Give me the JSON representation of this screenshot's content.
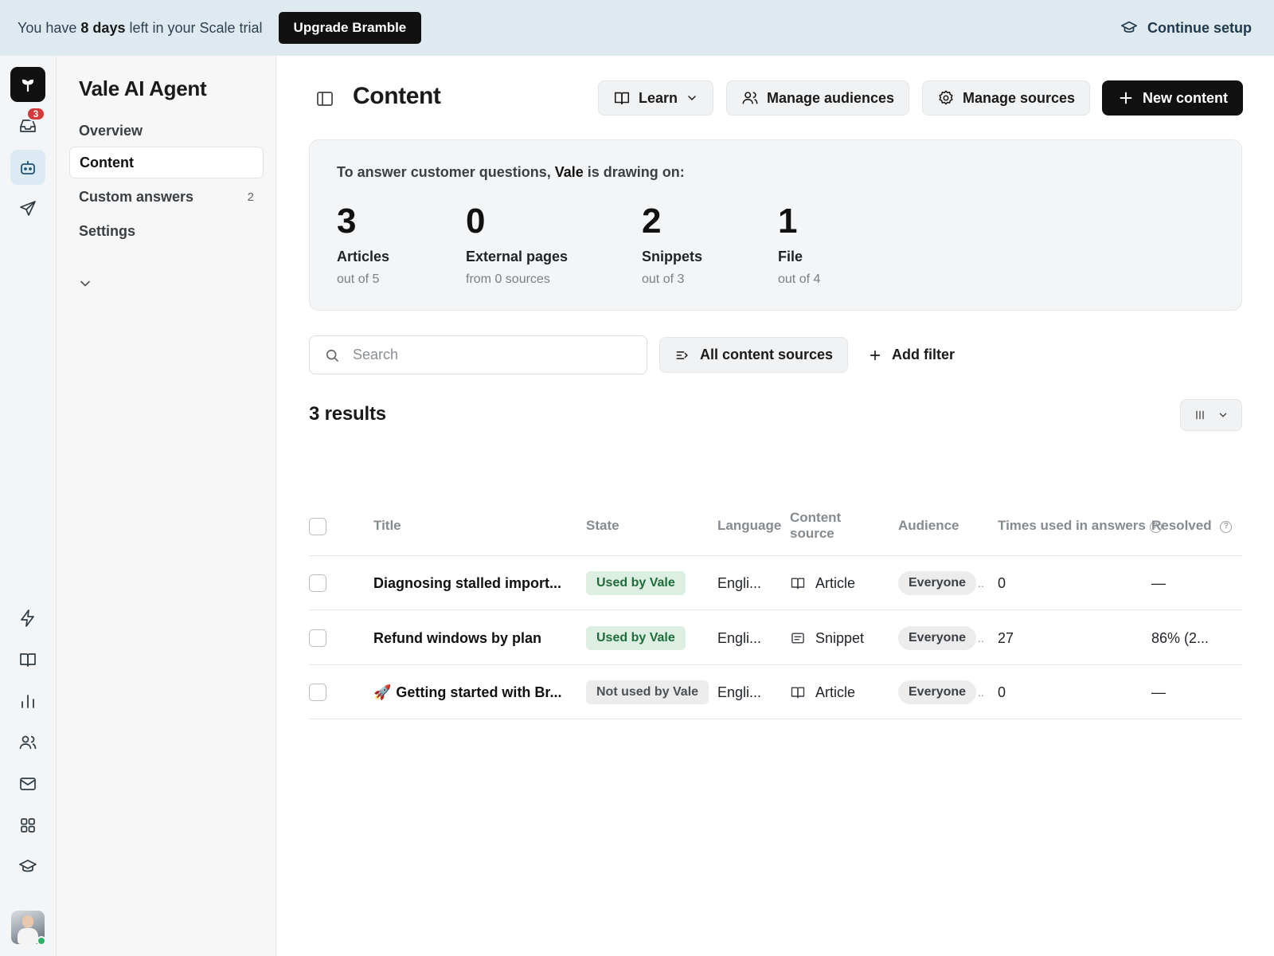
{
  "banner": {
    "text_prefix": "You have ",
    "days_bold": "8 days",
    "text_suffix": " left in your Scale trial",
    "upgrade_label": "Upgrade Bramble",
    "continue_label": "Continue setup"
  },
  "rail": {
    "inbox_badge": "3",
    "icons": [
      "logo-icon",
      "inbox-icon",
      "bot-icon",
      "send-icon",
      "bolt-icon",
      "book-icon",
      "chart-icon",
      "users-icon",
      "mail-icon",
      "apps-icon",
      "graduation-cap-icon"
    ]
  },
  "nav": {
    "title": "Vale AI Agent",
    "items": [
      {
        "label": "Overview",
        "count": ""
      },
      {
        "label": "Content",
        "count": ""
      },
      {
        "label": "Custom answers",
        "count": "2"
      },
      {
        "label": "Settings",
        "count": ""
      }
    ],
    "active_item": "Content"
  },
  "header": {
    "title": "Content",
    "learn_label": "Learn",
    "manage_audiences_label": "Manage audiences",
    "manage_sources_label": "Manage sources",
    "new_content_label": "New content"
  },
  "summary": {
    "heading_prefix": "To answer customer questions, ",
    "heading_agent": "Vale",
    "heading_suffix": " is drawing on:",
    "stats": [
      {
        "value": "3",
        "label": "Articles",
        "sub": "out of 5"
      },
      {
        "value": "0",
        "label": "External pages",
        "sub": "from 0 sources"
      },
      {
        "value": "2",
        "label": "Snippets",
        "sub": "out of 3"
      },
      {
        "value": "1",
        "label": "File",
        "sub": "out of 4"
      }
    ]
  },
  "filters": {
    "search_placeholder": "Search",
    "sources_label": "All content sources",
    "add_filter_label": "Add filter"
  },
  "results_label": "3 results",
  "table": {
    "columns": {
      "title": "Title",
      "state": "State",
      "language": "Language",
      "source_line1": "Content",
      "source_line2": "source",
      "audience": "Audience",
      "times_used": "Times used in answers",
      "resolved": "Resolved"
    },
    "rows": [
      {
        "emoji": "",
        "title": "Diagnosing stalled import...",
        "state": "Used by Vale",
        "state_kind": "used",
        "language": "Engli...",
        "source": "Article",
        "source_icon": "book-icon",
        "audience": "Everyone",
        "times_used": "0",
        "resolved": "—"
      },
      {
        "emoji": "",
        "title": "Refund windows by plan",
        "state": "Used by Vale",
        "state_kind": "used",
        "language": "Engli...",
        "source": "Snippet",
        "source_icon": "snippet-icon",
        "audience": "Everyone",
        "times_used": "27",
        "resolved": "86% (2..."
      },
      {
        "emoji": "🚀",
        "title": "Getting started with Br...",
        "state": "Not used by Vale",
        "state_kind": "notused",
        "language": "Engli...",
        "source": "Article",
        "source_icon": "book-icon",
        "audience": "Everyone",
        "times_used": "0",
        "resolved": "—"
      }
    ]
  },
  "colors": {
    "banner_bg": "#dfeaf0",
    "used_pill_bg": "#dcefe2",
    "used_pill_text": "#1f6b3b",
    "badge_red": "#d33a3a",
    "primary_dark": "#111111"
  }
}
